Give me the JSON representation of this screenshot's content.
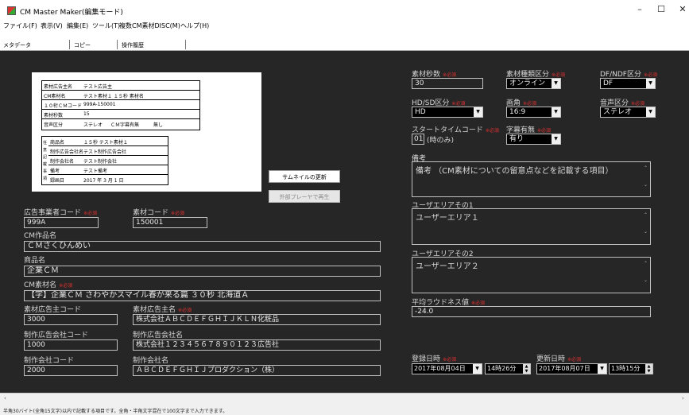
{
  "window": {
    "title": "CM Master Maker(編集モード)",
    "controls": [
      "–",
      "☐",
      "✕"
    ]
  },
  "menu": [
    "ファイル(F)",
    "表示(V)",
    "編集(E)",
    "ツール(T)",
    "複数CM素材DISC(M)",
    "ヘルプ(H)"
  ],
  "tabs": [
    "メタデータ",
    "コピー",
    "操作履歴"
  ],
  "req": "※必須",
  "preview": {
    "rows_top": [
      {
        "k": "素材広告主名",
        "v": "テスト広告主"
      },
      {
        "k": "CM素材名",
        "v": "テスト素材１ １５秒 素材名"
      },
      {
        "k": "１０桁ＣＭコード",
        "v": "999A-150001"
      },
      {
        "k": "素材秒数",
        "v": "15"
      },
      {
        "k": "音声区分",
        "v": "ステレオ",
        "v2": "ＣＭ字幕有無",
        "v3": "無し"
      }
    ],
    "side_label": "任意記載事項",
    "rows_bottom": [
      {
        "k": "商品名",
        "v": "１５秒 テスト素材１"
      },
      {
        "k": "制作広告会社名",
        "v": "テスト制作広告会社"
      },
      {
        "k": "制作会社名",
        "v": "テスト制作会社"
      },
      {
        "k": "備考",
        "v": "テスト備考"
      },
      {
        "k": "録画日",
        "v": "2017 年 3 月 1 日"
      }
    ]
  },
  "buttons": {
    "thumb": "サムネイルの更新",
    "play": "外部プレーヤで再生"
  },
  "left": {
    "advertiser_code": {
      "label": "広告事業者コード",
      "value": "999A"
    },
    "material_code": {
      "label": "素材コード",
      "value": "150001"
    },
    "cm_title": {
      "label": "CM作品名",
      "value": "ＣＭさくひんめい"
    },
    "product": {
      "label": "商品名",
      "value": "企業ＣＭ"
    },
    "cm_material": {
      "label": "CM素材名",
      "value": "【字】企業ＣＭ さわやかスマイル春が来る篇 ３０秒 北海道Ａ"
    },
    "sponsor_code": {
      "label": "素材広告主コード",
      "value": "3000"
    },
    "sponsor_name": {
      "label": "素材広告主名",
      "value": "株式会社ＡＢＣＤＥＦＧＨＩＪＫＬＮ化粧品"
    },
    "agency_code": {
      "label": "制作広告会社コード",
      "value": "1000"
    },
    "agency_name": {
      "label": "制作広告会社名",
      "value": "株式会社１２３４５６７８９０１２３広告社"
    },
    "prod_code": {
      "label": "制作会社コード",
      "value": "2000"
    },
    "prod_name": {
      "label": "制作会社名",
      "value": "ＡＢＣＤＥＦＧＨＩＪプロダクション（株）"
    }
  },
  "right": {
    "seconds": {
      "label": "素材秒数",
      "value": "30"
    },
    "kind": {
      "label": "素材種類区分",
      "value": "オンライン"
    },
    "df": {
      "label": "DF/NDF区分",
      "value": "DF"
    },
    "hdsd": {
      "label": "HD/SD区分",
      "value": "HD"
    },
    "aspect": {
      "label": "画角",
      "value": "16:9"
    },
    "audio": {
      "label": "音声区分",
      "value": "ステレオ"
    },
    "start": {
      "label": "スタートタイムコード",
      "value": "01",
      "unit": "(時のみ)"
    },
    "caption": {
      "label": "字幕有無",
      "value": "有り"
    },
    "notes": {
      "label": "備考",
      "value": "備考 （CM素材についての留意点などを記載する項目）"
    },
    "ua1": {
      "label": "ユーザエリアその1",
      "value": "ユーザーエリア１"
    },
    "ua2": {
      "label": "ユーザエリアその2",
      "value": "ユーザーエリア２"
    },
    "loud": {
      "label": "平均ラウドネス値",
      "value": "-24.0"
    },
    "reg": {
      "label": "登録日時",
      "date": "2017年08月04日",
      "time": "14時26分"
    },
    "upd": {
      "label": "更新日時",
      "date": "2017年08月07日",
      "time": "13時15分"
    }
  },
  "status": "半角30バイト(全角15文字)以内で記載する項目です。全角・半角文字混在で100文字まで入力できます。"
}
